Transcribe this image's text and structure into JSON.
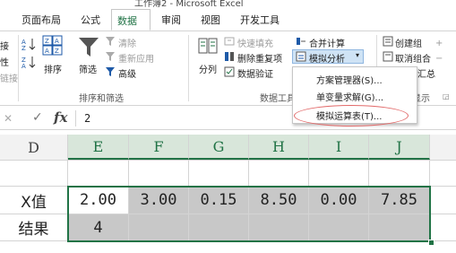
{
  "window": {
    "title": "工作簿2 - Microsoft Excel"
  },
  "tabs": [
    {
      "label": "页面布局"
    },
    {
      "label": "公式"
    },
    {
      "label": "数据"
    },
    {
      "label": "审阅"
    },
    {
      "label": "视图"
    },
    {
      "label": "开发工具"
    }
  ],
  "ribbon": {
    "left_cut": {
      "l1": "接",
      "l2": "性",
      "l3": "链接"
    },
    "sort_filter": {
      "sort_label": "排序",
      "filter_label": "筛选",
      "clear_label": "清除",
      "reapply_label": "重新应用",
      "advanced_label": "高级",
      "group_label": "排序和筛选"
    },
    "data_tools": {
      "split_label": "分列",
      "flash_fill_label": "快速填充",
      "remove_dup_label": "删除重复项",
      "validation_label": "数据验证",
      "consolidate_label": "合并计算",
      "whatif_label": "模拟分析",
      "group_label": "数据工具"
    },
    "outline": {
      "group_label": "创建组",
      "ungroup_label": "取消组合",
      "subtotal_label": "汇总",
      "show_label": "显示"
    }
  },
  "whatif_menu": {
    "items": [
      {
        "label": "方案管理器(S)..."
      },
      {
        "label": "单变量求解(G)..."
      },
      {
        "label": "模拟运算表(T)..."
      }
    ]
  },
  "formula_bar": {
    "fx": "fx",
    "value": "2"
  },
  "sheet": {
    "columns": [
      "D",
      "E",
      "F",
      "G",
      "H",
      "I",
      "J"
    ],
    "rows": [
      {
        "label": "X值",
        "cells": [
          "2.00",
          "3.00",
          "0.15",
          "8.50",
          "0.00",
          "7.85"
        ]
      },
      {
        "label": "结果",
        "cells": [
          "4",
          "",
          "",
          "",
          "",
          ""
        ]
      }
    ]
  },
  "colors": {
    "accent": "#217346",
    "highlight_oval": "#e26a6a"
  }
}
